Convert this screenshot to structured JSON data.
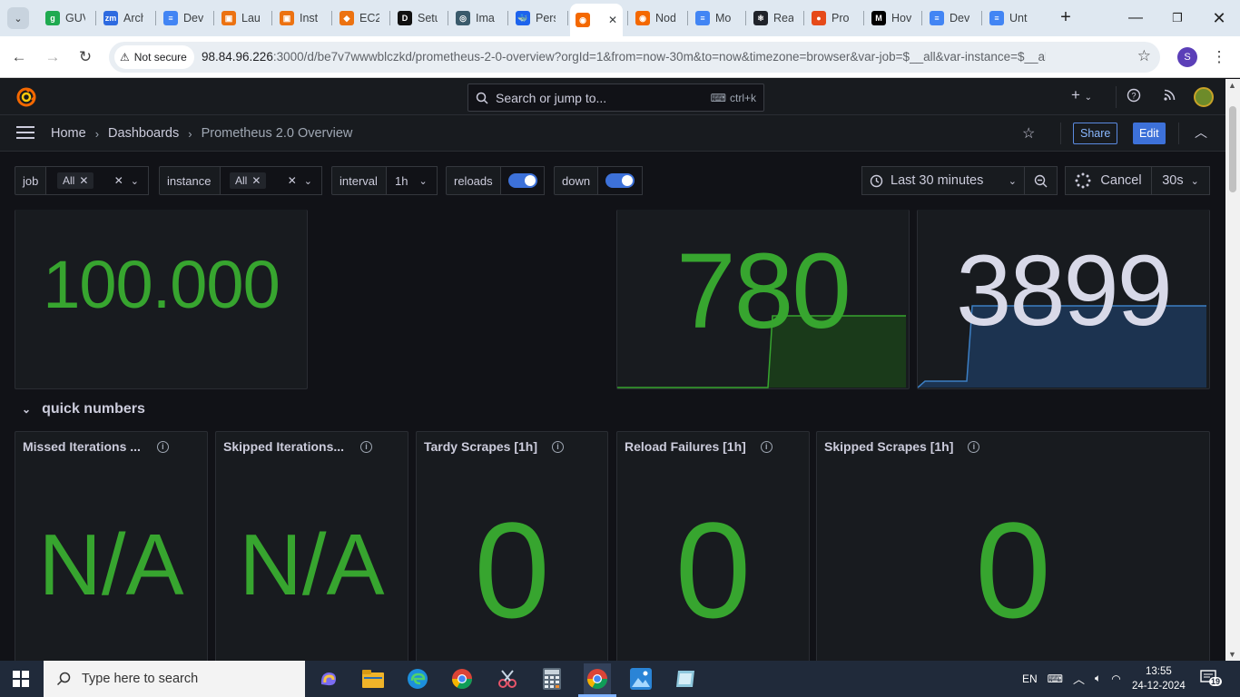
{
  "browser": {
    "tabs": [
      {
        "label": "GUVI",
        "color": "#1faa50",
        "glyph": "g"
      },
      {
        "label": "Arch",
        "color": "#2d6ae0",
        "glyph": "zm"
      },
      {
        "label": "Dev",
        "color": "#4285f4",
        "glyph": "≡"
      },
      {
        "label": "Lau",
        "color": "#ec7211",
        "glyph": "▣"
      },
      {
        "label": "Inst",
        "color": "#ec7211",
        "glyph": "▣"
      },
      {
        "label": "EC2",
        "color": "#ec7211",
        "glyph": "◆"
      },
      {
        "label": "Setu",
        "color": "#111111",
        "glyph": "D"
      },
      {
        "label": "Ima",
        "color": "#3a5a6b",
        "glyph": "◎"
      },
      {
        "label": "Pers",
        "color": "#1d63ed",
        "glyph": "🐳"
      },
      {
        "label": "",
        "color": "#f46800",
        "glyph": "◉",
        "active": true
      },
      {
        "label": "Nod",
        "color": "#f46800",
        "glyph": "◉"
      },
      {
        "label": "Mo",
        "color": "#4285f4",
        "glyph": "≡"
      },
      {
        "label": "Rea",
        "color": "#20232a",
        "glyph": "⚛"
      },
      {
        "label": "Pro",
        "color": "#e64a19",
        "glyph": "●"
      },
      {
        "label": "Hov",
        "color": "#000000",
        "glyph": "M"
      },
      {
        "label": "Dev",
        "color": "#4285f4",
        "glyph": "≡"
      },
      {
        "label": "Unt",
        "color": "#4285f4",
        "glyph": "≡"
      }
    ],
    "url_host": "98.84.96.226",
    "url_rest": ":3000/d/be7v7wwwblczkd/prometheus-2-0-overview?orgId=1&from=now-30m&to=now&timezone=browser&var-job=$__all&var-instance=$__all&v...",
    "not_secure": "Not secure",
    "profile_initial": "S"
  },
  "grafana": {
    "search_placeholder": "Search or jump to...",
    "search_shortcut": "ctrl+k",
    "breadcrumb": [
      "Home",
      "Dashboards",
      "Prometheus 2.0 Overview"
    ],
    "share_label": "Share",
    "edit_label": "Edit",
    "variables": {
      "job_label": "job",
      "job_value": "All",
      "instance_label": "instance",
      "instance_value": "All",
      "interval_label": "interval",
      "interval_value": "1h",
      "reloads_label": "reloads",
      "down_label": "down"
    },
    "time_range": "Last 30 minutes",
    "cancel_label": "Cancel",
    "refresh_interval": "30s",
    "top_panels": [
      {
        "value": "100.000",
        "color": "#37a52f"
      },
      {
        "value": "780",
        "color": "#37a52f",
        "spark_color": "#37a52f",
        "spark_fill": "#1a3a1a"
      },
      {
        "value": "3899",
        "color": "#d8d9e8",
        "spark_color": "#3c7fc4",
        "spark_fill": "#1c3350"
      }
    ],
    "row_title": "quick numbers",
    "stat_panels": [
      {
        "title": "Missed Iterations ...",
        "value": "N/A"
      },
      {
        "title": "Skipped Iterations...",
        "value": "N/A"
      },
      {
        "title": "Tardy Scrapes [1h]",
        "value": "0"
      },
      {
        "title": "Reload Failures [1h]",
        "value": "0"
      },
      {
        "title": "Skipped Scrapes [1h]",
        "value": "0"
      }
    ],
    "stat_color": "#37a52f"
  },
  "taskbar": {
    "search_placeholder": "Type here to search",
    "language": "EN",
    "time": "13:55",
    "date": "24-12-2024",
    "notifications": "19"
  }
}
